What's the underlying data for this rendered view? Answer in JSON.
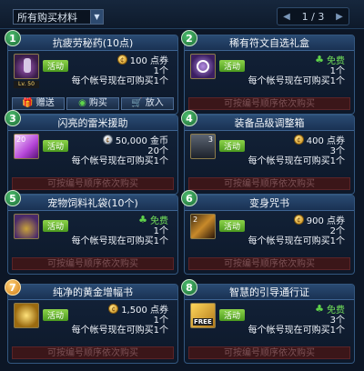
{
  "header": {
    "filter_label": "所有购买材料",
    "dropdown_arrow": "▼",
    "prev_icon": "◀",
    "page": "1 / 3",
    "next_icon": "▶"
  },
  "cards": [
    {
      "number": "1",
      "title": "抗疲劳秘药(10点)",
      "badge": "活动",
      "price": "100 点券",
      "qty": "1个",
      "limit": "每个帐号现在可购买1个",
      "level_label": "Lv. 50",
      "buttons": [
        "赠送",
        "购买",
        "放入"
      ]
    },
    {
      "number": "2",
      "title": "稀有符文自选礼盒",
      "badge": "活动",
      "price": "免费",
      "qty": "1个",
      "limit": "每个帐号现在可购买1个",
      "action": "可按编号顺序依次购买"
    },
    {
      "number": "3",
      "title": "闪亮的雷米援助",
      "badge": "活动",
      "price": "50,000 金币",
      "qty": "20个",
      "limit": "每个帐号现在可购买1个",
      "icon_count": "20",
      "action": "可按编号顺序依次购买"
    },
    {
      "number": "4",
      "title": "装备品级调整箱",
      "badge": "活动",
      "price": "400 点券",
      "qty": "3个",
      "limit": "每个帐号现在可购买1个",
      "icon_count": "3",
      "action": "可按编号顺序依次购买"
    },
    {
      "number": "5",
      "title": "宠物饲料礼袋(10个)",
      "badge": "活动",
      "price": "免费",
      "qty": "1个",
      "limit": "每个帐号现在可购买1个",
      "action": "可按编号顺序依次购买"
    },
    {
      "number": "6",
      "title": "变身咒书",
      "badge": "活动",
      "price": "900 点券",
      "qty": "2个",
      "limit": "每个帐号现在可购买1个",
      "icon_count": "2",
      "action": "可按编号顺序依次购买"
    },
    {
      "number": "7",
      "title": "纯净的黄金增幅书",
      "badge": "活动",
      "price": "1,500 点券",
      "qty": "1个",
      "limit": "每个帐号现在可购买1个",
      "action": "可按编号顺序依次购买"
    },
    {
      "number": "8",
      "title": "智慧的引导通行证",
      "badge": "活动",
      "price": "免费",
      "qty": "3个",
      "limit": "每个帐号现在可购买1个",
      "icon_text": "FREE",
      "action": "可按编号顺序依次购买"
    }
  ],
  "colors": {
    "background": "#0c1626",
    "card_head": "#2a4a72",
    "badge_green": "#6bb82f",
    "action_disabled": "#3b1619",
    "number_green": "#2f9a4f",
    "number_gold": "#e8981e"
  }
}
